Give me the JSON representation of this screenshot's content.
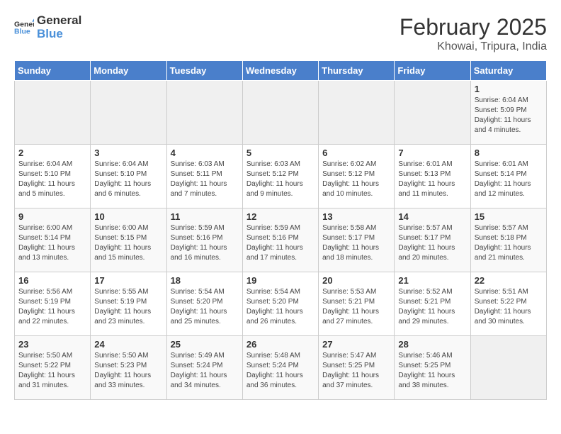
{
  "header": {
    "logo_general": "General",
    "logo_blue": "Blue",
    "month_year": "February 2025",
    "location": "Khowai, Tripura, India"
  },
  "weekdays": [
    "Sunday",
    "Monday",
    "Tuesday",
    "Wednesday",
    "Thursday",
    "Friday",
    "Saturday"
  ],
  "weeks": [
    [
      {
        "day": "",
        "info": ""
      },
      {
        "day": "",
        "info": ""
      },
      {
        "day": "",
        "info": ""
      },
      {
        "day": "",
        "info": ""
      },
      {
        "day": "",
        "info": ""
      },
      {
        "day": "",
        "info": ""
      },
      {
        "day": "1",
        "info": "Sunrise: 6:04 AM\nSunset: 5:09 PM\nDaylight: 11 hours and 4 minutes."
      }
    ],
    [
      {
        "day": "2",
        "info": "Sunrise: 6:04 AM\nSunset: 5:10 PM\nDaylight: 11 hours and 5 minutes."
      },
      {
        "day": "3",
        "info": "Sunrise: 6:04 AM\nSunset: 5:10 PM\nDaylight: 11 hours and 6 minutes."
      },
      {
        "day": "4",
        "info": "Sunrise: 6:03 AM\nSunset: 5:11 PM\nDaylight: 11 hours and 7 minutes."
      },
      {
        "day": "5",
        "info": "Sunrise: 6:03 AM\nSunset: 5:12 PM\nDaylight: 11 hours and 9 minutes."
      },
      {
        "day": "6",
        "info": "Sunrise: 6:02 AM\nSunset: 5:12 PM\nDaylight: 11 hours and 10 minutes."
      },
      {
        "day": "7",
        "info": "Sunrise: 6:01 AM\nSunset: 5:13 PM\nDaylight: 11 hours and 11 minutes."
      },
      {
        "day": "8",
        "info": "Sunrise: 6:01 AM\nSunset: 5:14 PM\nDaylight: 11 hours and 12 minutes."
      }
    ],
    [
      {
        "day": "9",
        "info": "Sunrise: 6:00 AM\nSunset: 5:14 PM\nDaylight: 11 hours and 13 minutes."
      },
      {
        "day": "10",
        "info": "Sunrise: 6:00 AM\nSunset: 5:15 PM\nDaylight: 11 hours and 15 minutes."
      },
      {
        "day": "11",
        "info": "Sunrise: 5:59 AM\nSunset: 5:16 PM\nDaylight: 11 hours and 16 minutes."
      },
      {
        "day": "12",
        "info": "Sunrise: 5:59 AM\nSunset: 5:16 PM\nDaylight: 11 hours and 17 minutes."
      },
      {
        "day": "13",
        "info": "Sunrise: 5:58 AM\nSunset: 5:17 PM\nDaylight: 11 hours and 18 minutes."
      },
      {
        "day": "14",
        "info": "Sunrise: 5:57 AM\nSunset: 5:17 PM\nDaylight: 11 hours and 20 minutes."
      },
      {
        "day": "15",
        "info": "Sunrise: 5:57 AM\nSunset: 5:18 PM\nDaylight: 11 hours and 21 minutes."
      }
    ],
    [
      {
        "day": "16",
        "info": "Sunrise: 5:56 AM\nSunset: 5:19 PM\nDaylight: 11 hours and 22 minutes."
      },
      {
        "day": "17",
        "info": "Sunrise: 5:55 AM\nSunset: 5:19 PM\nDaylight: 11 hours and 23 minutes."
      },
      {
        "day": "18",
        "info": "Sunrise: 5:54 AM\nSunset: 5:20 PM\nDaylight: 11 hours and 25 minutes."
      },
      {
        "day": "19",
        "info": "Sunrise: 5:54 AM\nSunset: 5:20 PM\nDaylight: 11 hours and 26 minutes."
      },
      {
        "day": "20",
        "info": "Sunrise: 5:53 AM\nSunset: 5:21 PM\nDaylight: 11 hours and 27 minutes."
      },
      {
        "day": "21",
        "info": "Sunrise: 5:52 AM\nSunset: 5:21 PM\nDaylight: 11 hours and 29 minutes."
      },
      {
        "day": "22",
        "info": "Sunrise: 5:51 AM\nSunset: 5:22 PM\nDaylight: 11 hours and 30 minutes."
      }
    ],
    [
      {
        "day": "23",
        "info": "Sunrise: 5:50 AM\nSunset: 5:22 PM\nDaylight: 11 hours and 31 minutes."
      },
      {
        "day": "24",
        "info": "Sunrise: 5:50 AM\nSunset: 5:23 PM\nDaylight: 11 hours and 33 minutes."
      },
      {
        "day": "25",
        "info": "Sunrise: 5:49 AM\nSunset: 5:24 PM\nDaylight: 11 hours and 34 minutes."
      },
      {
        "day": "26",
        "info": "Sunrise: 5:48 AM\nSunset: 5:24 PM\nDaylight: 11 hours and 36 minutes."
      },
      {
        "day": "27",
        "info": "Sunrise: 5:47 AM\nSunset: 5:25 PM\nDaylight: 11 hours and 37 minutes."
      },
      {
        "day": "28",
        "info": "Sunrise: 5:46 AM\nSunset: 5:25 PM\nDaylight: 11 hours and 38 minutes."
      },
      {
        "day": "",
        "info": ""
      }
    ]
  ]
}
